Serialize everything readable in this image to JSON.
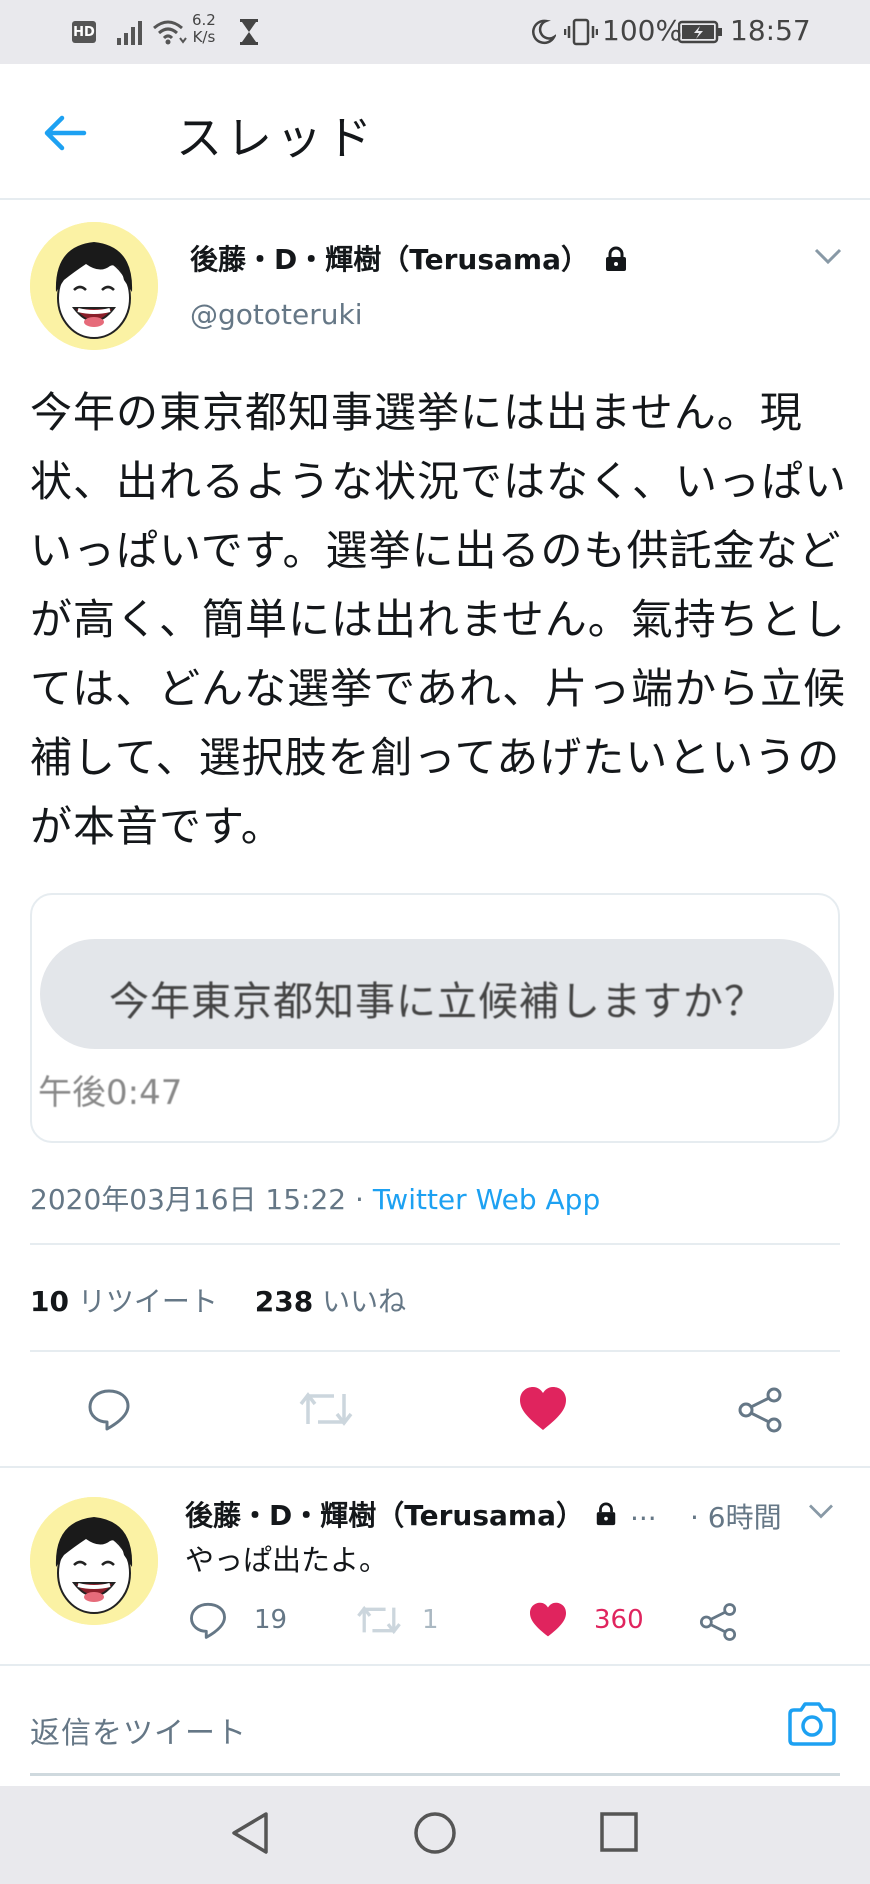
{
  "status_bar": {
    "hd": "HD",
    "net_speed_value": "6.2",
    "net_speed_unit": "K/s",
    "battery": "100%",
    "time": "18:57"
  },
  "header": {
    "title": "スレッド"
  },
  "main_tweet": {
    "display_name": "後藤・D・輝樹（Terusama）",
    "handle": "@gototeruki",
    "text": "今年の東京都知事選挙には出ません。現状、出れるような状況ではなく、いっぱいいっぱいです。選挙に出るのも供託金などが高く、簡単には出れません。氣持ちとしては、どんな選挙であれ、片っ端から立候補して、選択肢を創ってあげたいというのが本音です。",
    "media": {
      "bubble_text": "今年東京都知事に立候補しますか？",
      "bubble_time": "午後0:47"
    },
    "date": "2020年03月16日 15:22",
    "separator": "·",
    "source": "Twitter Web App",
    "retweet_count": "10",
    "retweet_label": "リツイート",
    "like_count": "238",
    "like_label": "いいね"
  },
  "reply_tweet": {
    "display_name": "後藤・D・輝樹（Terusama）",
    "ellipsis": "...",
    "time": "· 6時間",
    "text": "やっぱ出たよ。",
    "reply_count": "19",
    "retweet_count": "1",
    "like_count": "360"
  },
  "compose": {
    "placeholder": "返信をツイート"
  },
  "colors": {
    "accent": "#1da1f2",
    "like": "#e0245e",
    "muted": "#657786",
    "text": "#14171a",
    "border": "#e6ecf0"
  },
  "icons": {
    "back": "arrow-left-icon",
    "lock": "lock-icon",
    "chevron": "chevron-down-icon",
    "reply": "reply-icon",
    "retweet": "retweet-icon",
    "like": "heart-icon",
    "share": "share-icon",
    "camera": "camera-icon"
  }
}
